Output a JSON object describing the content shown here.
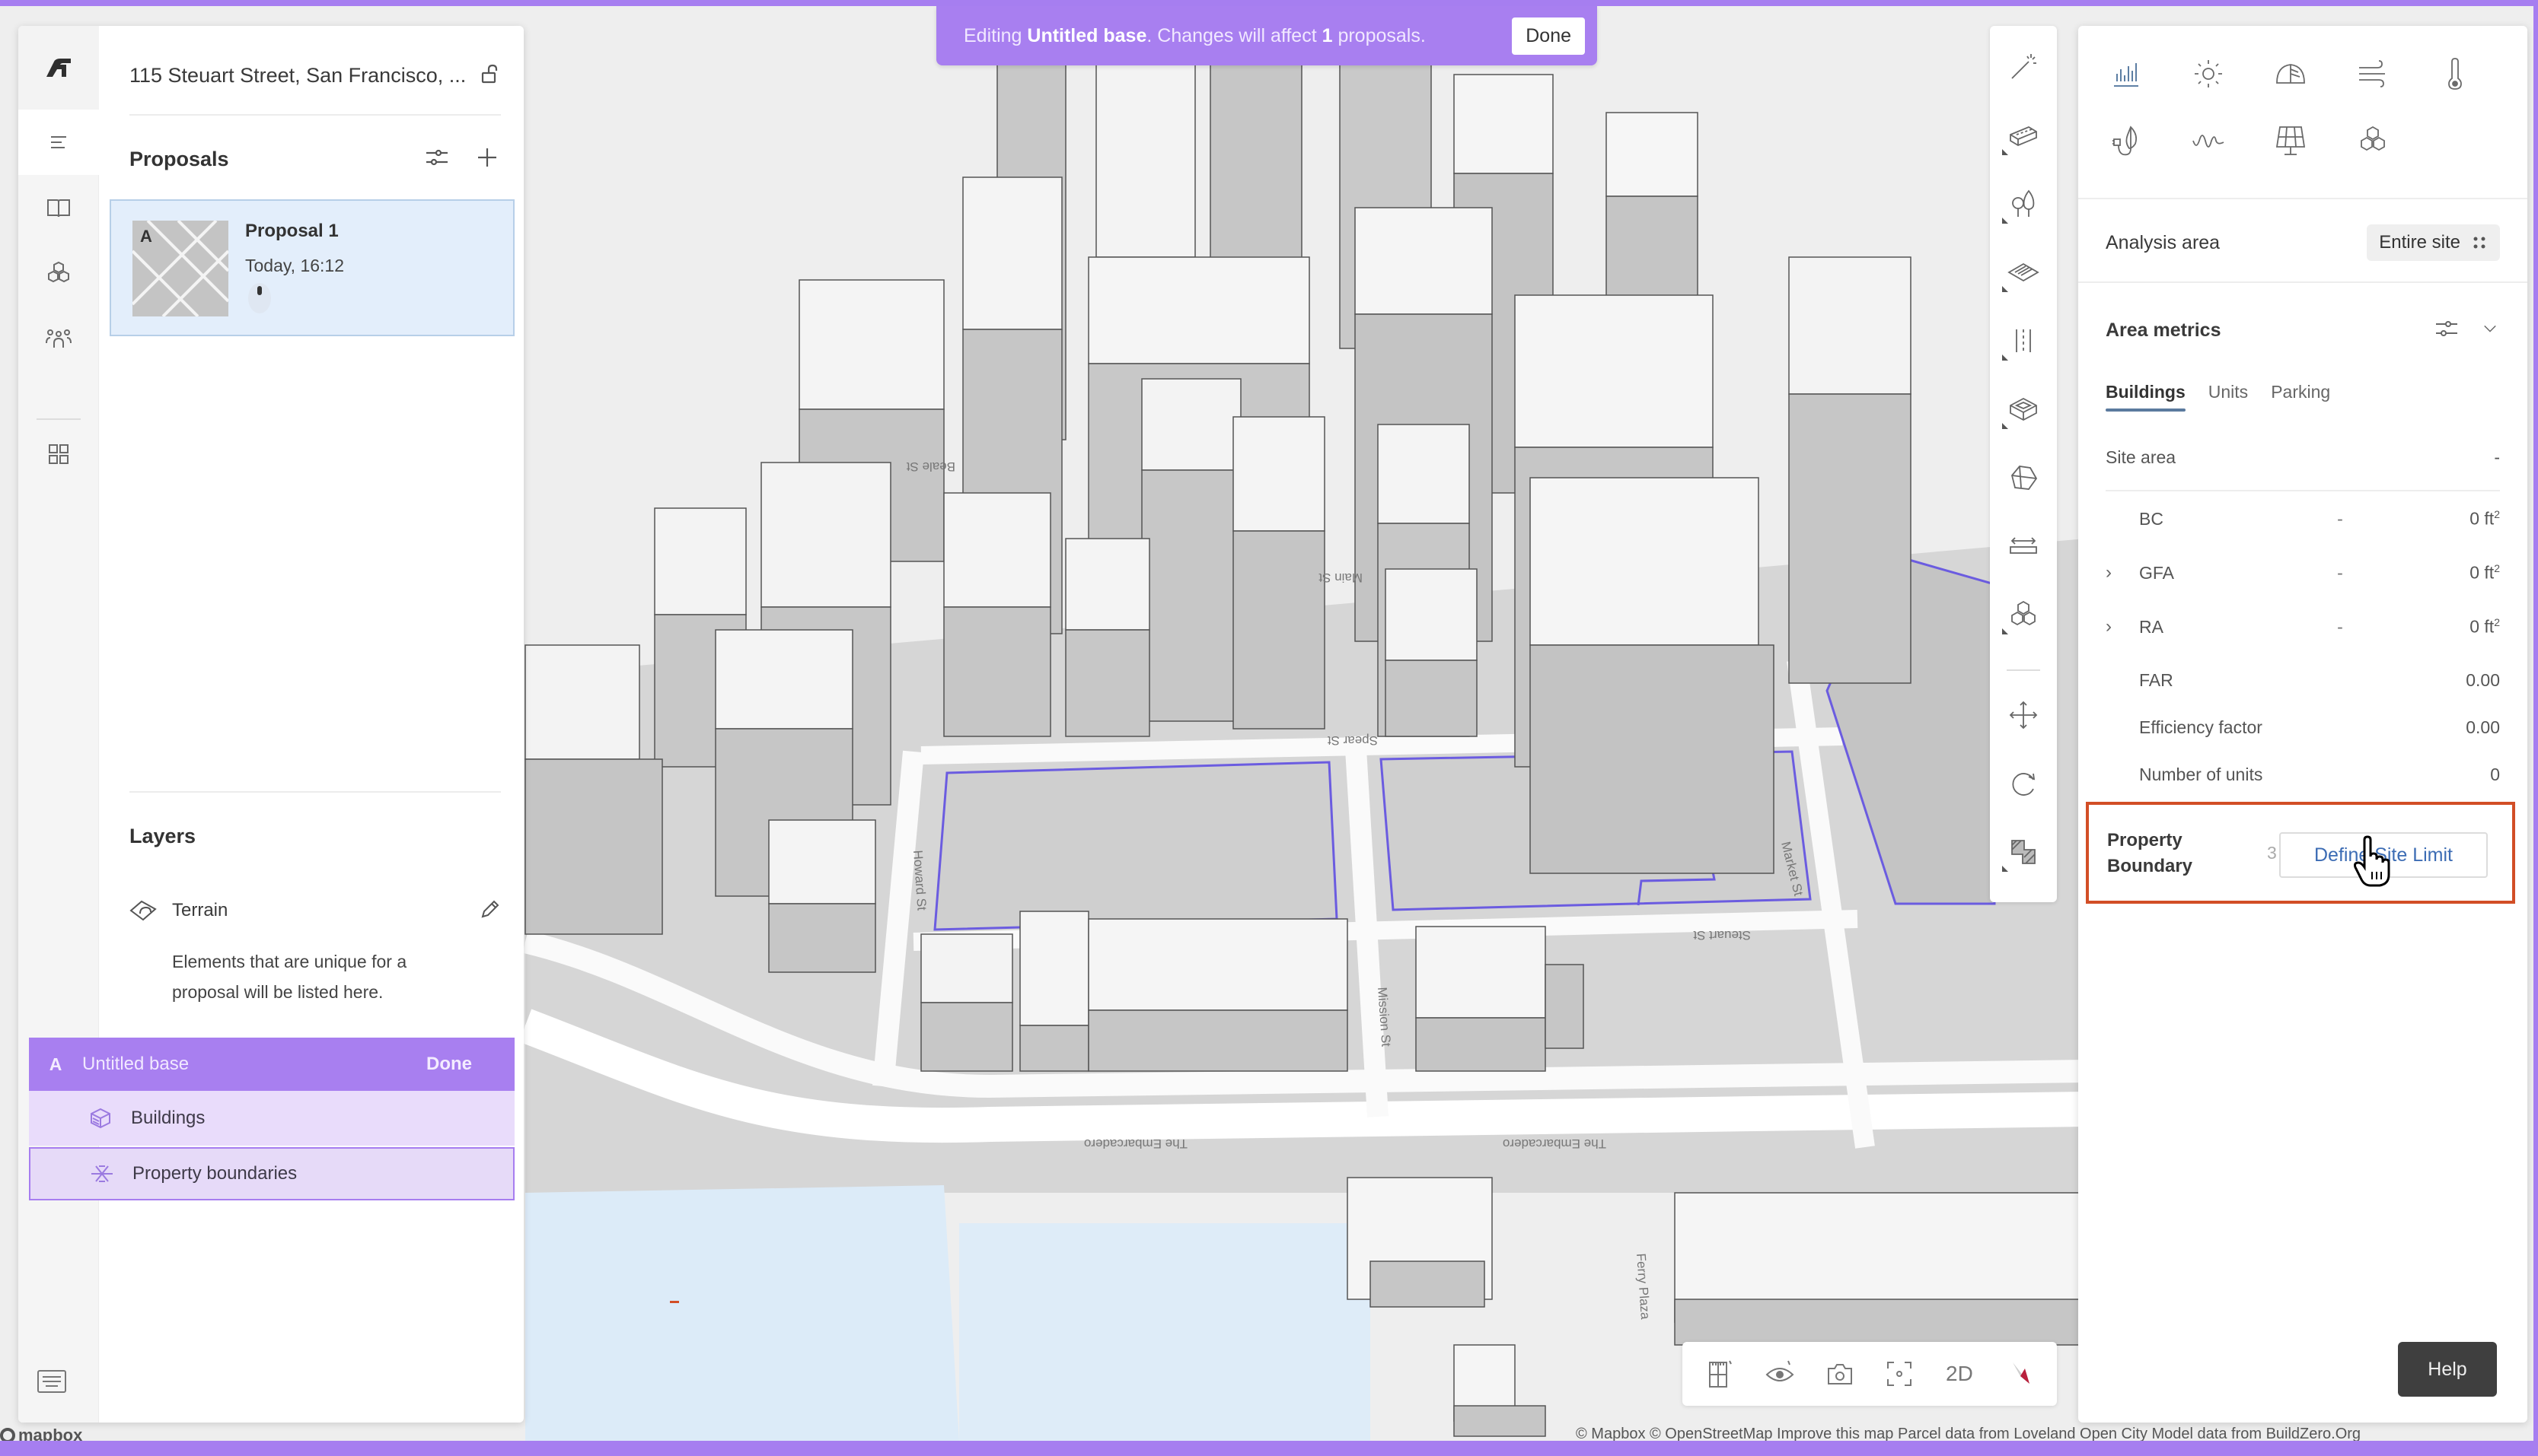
{
  "banner": {
    "prefix": "Editing ",
    "base_name": "Untitled base",
    "middle": ". Changes will affect ",
    "count": "1",
    "suffix": " proposals.",
    "done_label": "Done",
    "color": "#a87ff0"
  },
  "left_rail": {
    "items": [
      {
        "icon": "autodesk-logo-icon"
      },
      {
        "icon": "menu-icon",
        "active": true
      },
      {
        "icon": "book-icon"
      },
      {
        "icon": "cubes-icon"
      },
      {
        "icon": "people-icon"
      },
      {
        "icon": "grid-apps-icon"
      }
    ],
    "bottom_icon": "keyboard-icon"
  },
  "project": {
    "address": "115 Steuart Street, San Francisco, ..."
  },
  "proposals": {
    "title": "Proposals",
    "items": [
      {
        "letter": "A",
        "name": "Proposal 1",
        "time": "Today, 16:12"
      }
    ]
  },
  "layers": {
    "title": "Layers",
    "terrain_label": "Terrain",
    "hint": "Elements that are unique for a proposal will be listed here.",
    "base": {
      "letter": "A",
      "name": "Untitled base",
      "done_label": "Done"
    },
    "sub_layers": [
      {
        "label": "Buildings",
        "icon": "buildings-layer-icon"
      },
      {
        "label": "Property boundaries",
        "icon": "property-boundaries-icon",
        "selected": true
      }
    ]
  },
  "vertical_tools": [
    "magic-wand-icon",
    "building-tool-icon",
    "trees-icon",
    "surface-icon",
    "road-icon",
    "box-icon",
    "roof-icon",
    "measure-icon",
    "blocks-icon",
    "move-icon",
    "rotate-icon",
    "hatch-icon"
  ],
  "right_panel": {
    "analysis_icons": [
      "bar-chart-icon",
      "sun-icon",
      "daylight-dome-icon",
      "wind-icon",
      "thermometer-icon",
      "energy-leaf-icon",
      "noise-wave-icon",
      "solar-panel-icon",
      "cubes-analysis-icon"
    ],
    "analysis_area_label": "Analysis area",
    "analysis_area_value": "Entire site",
    "area_metrics_title": "Area metrics",
    "tabs": [
      "Buildings",
      "Units",
      "Parking"
    ],
    "active_tab": "Buildings",
    "site_area": {
      "label": "Site area",
      "value": "-"
    },
    "metrics": [
      {
        "label": "BC",
        "expandable": false,
        "dash": "-",
        "value": "0 ft",
        "unit_sup": "2"
      },
      {
        "label": "GFA",
        "expandable": true,
        "dash": "-",
        "value": "0 ft",
        "unit_sup": "2"
      },
      {
        "label": "RA",
        "expandable": true,
        "dash": "-",
        "value": "0 ft",
        "unit_sup": "2"
      },
      {
        "label": "FAR",
        "expandable": false,
        "dash": "",
        "value": "0.00",
        "unit_sup": ""
      },
      {
        "label": "Efficiency factor",
        "expandable": false,
        "dash": "",
        "value": "0.00",
        "unit_sup": ""
      },
      {
        "label": "Number of units",
        "expandable": false,
        "dash": "",
        "value": "0",
        "unit_sup": ""
      }
    ],
    "property_boundary": {
      "label_line1": "Property",
      "label_line2": "Boundary",
      "partial_value": "3",
      "button_label": "Define Site Limit",
      "highlight_color": "#d24e26"
    },
    "help_label": "Help"
  },
  "bottom_toolbar": {
    "items": [
      "floor-plan-icon",
      "visibility-icon",
      "camera-icon",
      "focus-icon",
      "2d-toggle",
      "compass-icon"
    ],
    "mode_label": "2D"
  },
  "map": {
    "street_labels": [
      "Howard St",
      "Spear St",
      "Steuart St",
      "Mission St",
      "Main St",
      "Market St",
      "The Embarcadero",
      "The Embarcadero",
      "Ferry Plaza",
      "Beale St"
    ],
    "attribution": "© Mapbox © OpenStreetMap Improve this map Parcel data from Loveland Open City Model data from BuildZero.Org",
    "logo_text": "mapbox",
    "boundary_color": "#6b5ce0",
    "water_color": "#dcebf8"
  }
}
